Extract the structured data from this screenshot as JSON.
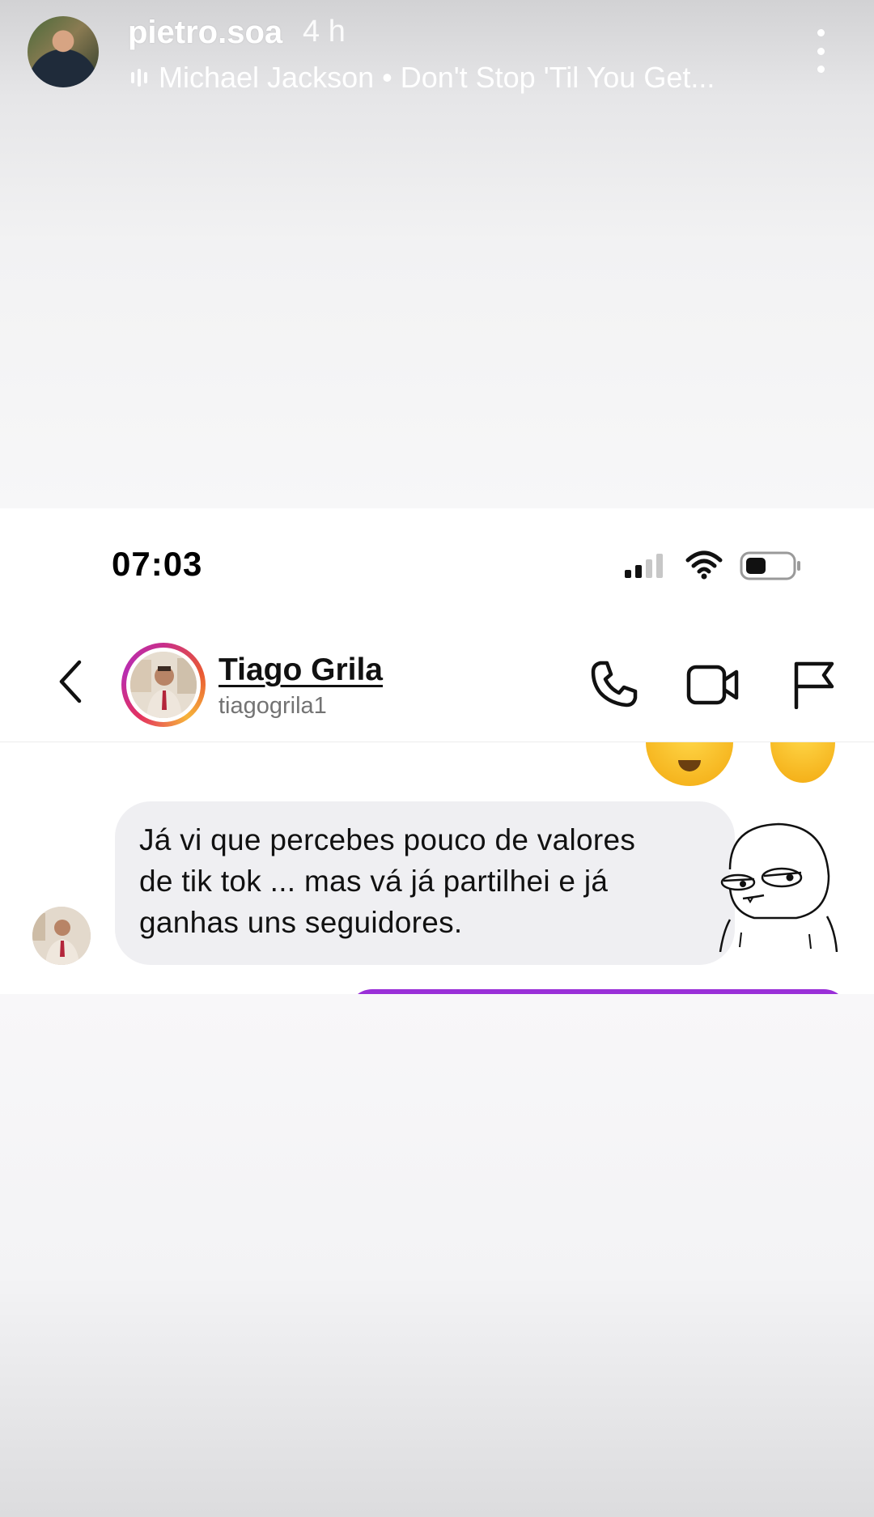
{
  "story": {
    "username": "pietro.soa",
    "time_ago": "4 h",
    "music": "Michael Jackson • Don't Stop 'Til You Get..."
  },
  "screenshot": {
    "status_bar": {
      "time": "07:03"
    },
    "contact": {
      "name": "Tiago Grila",
      "handle": "tiagogrila1"
    },
    "messages": [
      {
        "sender": "tiagogrila1",
        "lines": [
          "Já vi que percebes pouco de valores",
          "de tik tok ... mas vá já partilhei e já",
          "ganhas uns seguidores."
        ]
      }
    ]
  },
  "colors": {
    "outgoing_bubble": "#9a2fd8",
    "incoming_bubble": "#efeff2",
    "story_ring": [
      "#f6b43a",
      "#e95833",
      "#c82e8c"
    ]
  },
  "icons": [
    "back-chevron-icon",
    "phone-icon",
    "video-camera-icon",
    "flag-icon",
    "more-options-icon",
    "music-bars-icon",
    "signal-icon",
    "wifi-icon",
    "battery-icon"
  ]
}
